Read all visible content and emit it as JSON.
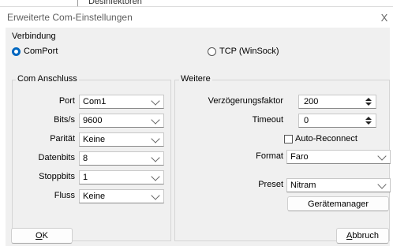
{
  "background": {
    "text": "Desinfektoren"
  },
  "window": {
    "title": "Erweiterte Com-Einstellungen",
    "close_label": "X"
  },
  "verbindung": {
    "label": "Verbindung",
    "options": [
      "ComPort",
      "TCP (WinSock)"
    ],
    "selected": "ComPort"
  },
  "com_anschluss": {
    "label": "Com Anschluss",
    "fields": [
      {
        "label": "Port",
        "value": "Com1"
      },
      {
        "label": "Bits/s",
        "value": "9600"
      },
      {
        "label": "Parität",
        "value": "Keine"
      },
      {
        "label": "Datenbits",
        "value": "8"
      },
      {
        "label": "Stoppbits",
        "value": "1"
      },
      {
        "label": "Fluss",
        "value": "Keine"
      }
    ]
  },
  "weitere": {
    "label": "Weitere",
    "verzoegerung_label": "Verzögerungsfaktor",
    "verzoegerung_value": "200",
    "timeout_label": "Timeout",
    "timeout_value": "0",
    "auto_reconnect_label": "Auto-Reconnect",
    "auto_reconnect_checked": false,
    "format_label": "Format",
    "format_value": "Faro",
    "preset_label": "Preset",
    "preset_value": "Nitram",
    "geraetemanager_label": "Gerätemanager"
  },
  "buttons": {
    "ok_hotkey": "O",
    "ok_rest": "K",
    "abbruch_hotkey": "A",
    "abbruch_rest": "bbruch"
  },
  "colors": {
    "accent": "#0067c0",
    "dialog_bg": "#f0f0f0"
  }
}
